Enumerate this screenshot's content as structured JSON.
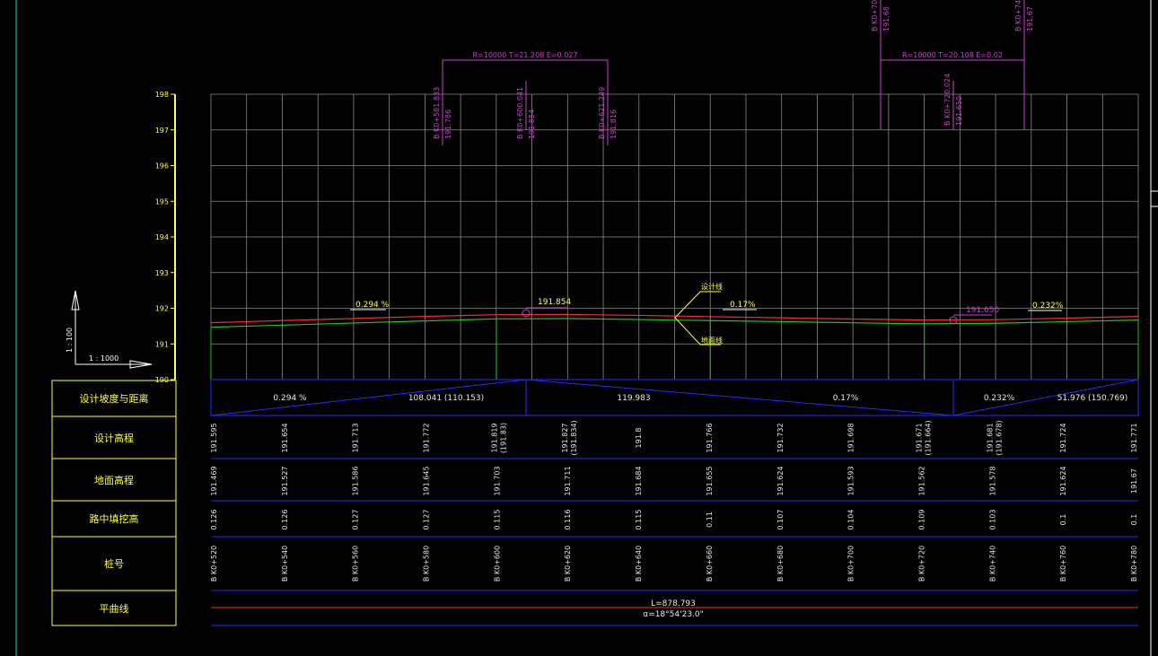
{
  "colors": {
    "background": "#000000",
    "grid": "#8a8a8a",
    "design_line": "#ff2a2a",
    "ground_line": "#22c422",
    "curve_annot": "#d040d0",
    "label_yellow": "#ffff40",
    "table_blue": "#2a2aff",
    "text_white": "#e8e8e8",
    "frame_cyan": "#20c8d8"
  },
  "scale": {
    "vertical": "1 : 100",
    "horizontal": "1 : 1000"
  },
  "y_axis_ticks": [
    "198",
    "197",
    "196",
    "195",
    "194",
    "193",
    "192",
    "191",
    "190"
  ],
  "row_titles": {
    "slope_distance": "设计坡度与距离",
    "design_elev": "设计高程",
    "ground_elev": "地面高程",
    "cut_fill": "路中填挖高",
    "station": "桩号",
    "plan_curve": "平曲线"
  },
  "slope_row": {
    "segments": [
      {
        "slope": "0.294 %",
        "distance": "108.041 (110.153)"
      },
      {
        "slope": "",
        "distance": "119.983"
      },
      {
        "slope": "0.17%",
        "distance": ""
      },
      {
        "slope": "0.232%",
        "distance": "51.976 (150.769)"
      }
    ]
  },
  "columns": [
    {
      "design": "191.595",
      "design_sub": "",
      "ground": "191.469",
      "cutfill": "0.126",
      "station": "B K0+520"
    },
    {
      "design": "191.654",
      "design_sub": "",
      "ground": "191.527",
      "cutfill": "0.126",
      "station": "B K0+540"
    },
    {
      "design": "191.713",
      "design_sub": "",
      "ground": "191.586",
      "cutfill": "0.127",
      "station": "B K0+560"
    },
    {
      "design": "191.772",
      "design_sub": "",
      "ground": "191.645",
      "cutfill": "0.127",
      "station": "B K0+580"
    },
    {
      "design": "191.819",
      "design_sub": "(191.83)",
      "ground": "191.703",
      "cutfill": "0.115",
      "station": "B K0+600"
    },
    {
      "design": "191.827",
      "design_sub": "(191.834)",
      "ground": "191.711",
      "cutfill": "0.116",
      "station": "B K0+620"
    },
    {
      "design": "191.8",
      "design_sub": "",
      "ground": "191.684",
      "cutfill": "0.115",
      "station": "B K0+640"
    },
    {
      "design": "191.766",
      "design_sub": "",
      "ground": "191.655",
      "cutfill": "0.11",
      "station": "B K0+660"
    },
    {
      "design": "191.732",
      "design_sub": "",
      "ground": "191.624",
      "cutfill": "0.107",
      "station": "B K0+680"
    },
    {
      "design": "191.698",
      "design_sub": "",
      "ground": "191.593",
      "cutfill": "0.104",
      "station": "B K0+700"
    },
    {
      "design": "191.671",
      "design_sub": "(191.664)",
      "ground": "191.562",
      "cutfill": "0.109",
      "station": "B K0+720"
    },
    {
      "design": "191.681",
      "design_sub": "(191.678)",
      "ground": "191.578",
      "cutfill": "0.103",
      "station": "B K0+740"
    },
    {
      "design": "191.724",
      "design_sub": "",
      "ground": "191.624",
      "cutfill": "0.1",
      "station": "B K0+760"
    },
    {
      "design": "191.771",
      "design_sub": "",
      "ground": "191.67",
      "cutfill": "0.1",
      "station": "B K0+780"
    }
  ],
  "plan_curve": {
    "line1": "L=878.793",
    "line2": "α=18°54'23.0\""
  },
  "vertical_curves": [
    {
      "params": "R=10000  T=21.208  E=0.027",
      "start": {
        "station": "B K0+581.833",
        "elev": "191.786"
      },
      "pvi": {
        "station": "B K0+600.041",
        "elev": "191.854"
      },
      "end": {
        "station": "B K0+621.249",
        "elev": "191.816"
      }
    },
    {
      "params": "R=10000  T=20.108  E=0.02",
      "start": {
        "station": "B K0+70",
        "elev": "191.68"
      },
      "pvi": {
        "station": "B K0+720.024",
        "elev": "191.650"
      },
      "end": {
        "station": "B K0+74",
        "elev": "191.67"
      }
    }
  ],
  "profile_annotations": {
    "grade1": "0.294 %",
    "grade2": "0.17%",
    "grade3": "0.232%",
    "pvi1_elev": "191.854",
    "pvi2_elev": "191.650",
    "leader_design": "设计线",
    "leader_ground": "地面线"
  },
  "chart_data": {
    "type": "line",
    "x_label_unit": "station (m)",
    "x": [
      520,
      540,
      560,
      580,
      600,
      620,
      640,
      660,
      680,
      700,
      720,
      740,
      760,
      780
    ],
    "ylim": [
      190,
      198
    ],
    "grid": true,
    "series": [
      {
        "name": "设计线",
        "values": [
          191.595,
          191.654,
          191.713,
          191.772,
          191.819,
          191.827,
          191.8,
          191.766,
          191.732,
          191.698,
          191.671,
          191.681,
          191.724,
          191.771
        ]
      },
      {
        "name": "地面线",
        "values": [
          191.469,
          191.527,
          191.586,
          191.645,
          191.703,
          191.711,
          191.684,
          191.655,
          191.624,
          191.593,
          191.562,
          191.578,
          191.624,
          191.67
        ]
      }
    ]
  }
}
